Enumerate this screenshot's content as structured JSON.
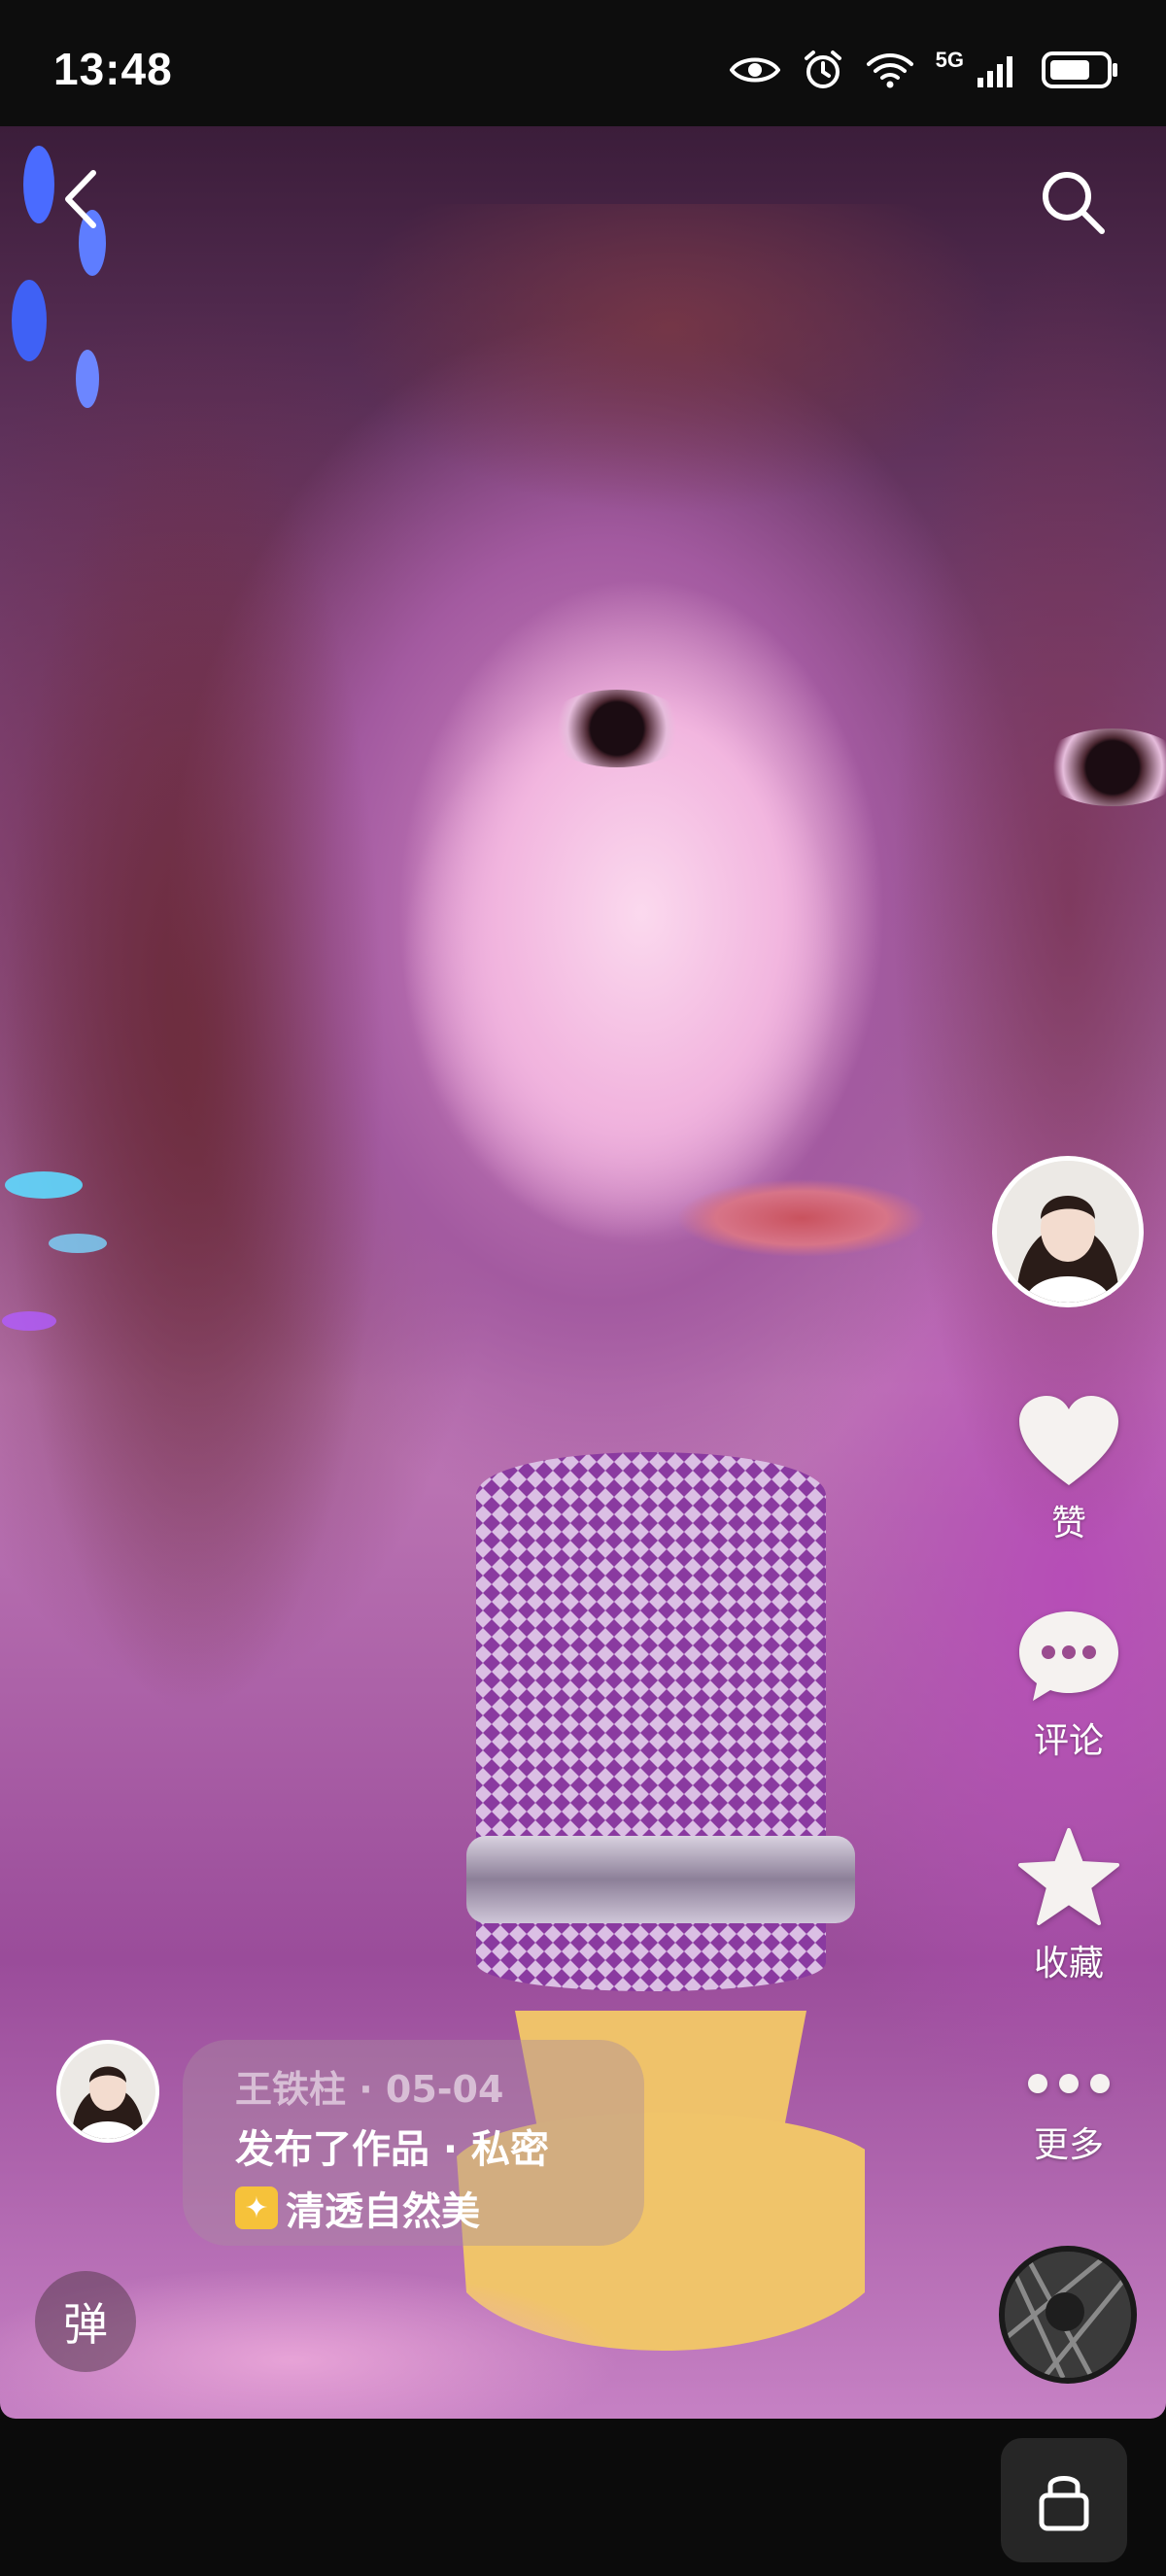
{
  "status_bar": {
    "time": "13:48",
    "network": "5G",
    "icons": [
      "eye-icon",
      "alarm-icon",
      "wifi-icon",
      "signal-icon",
      "battery-icon"
    ]
  },
  "top_bar": {
    "back_icon": "chevron-left-icon",
    "search_icon": "search-icon"
  },
  "actions": {
    "like_label": "赞",
    "comment_label": "评论",
    "favorite_label": "收藏",
    "more_label": "更多"
  },
  "post": {
    "author_date": "王铁柱 · 05-04",
    "status": "发布了作品 · 私密",
    "caption": "清透自然美",
    "caption_icon": "sparkle-icon"
  },
  "danmu_label": "弹",
  "colors": {
    "accent_star": "#f6c23a",
    "panel": "#262626"
  }
}
